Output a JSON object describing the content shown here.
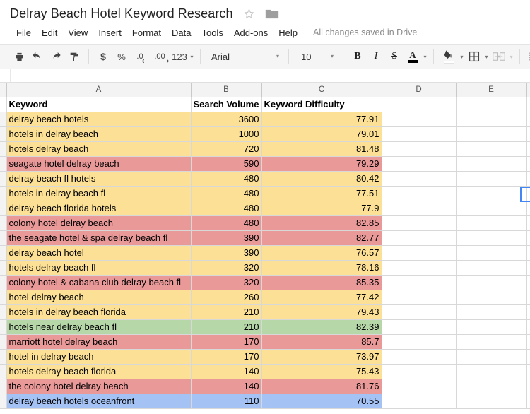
{
  "window": {
    "doc_title": "Delray Beach Hotel Keyword Research",
    "star_icon": "star-outline-icon",
    "folder_icon": "folder-icon"
  },
  "menubar": {
    "items": [
      {
        "label": "File"
      },
      {
        "label": "Edit"
      },
      {
        "label": "View"
      },
      {
        "label": "Insert"
      },
      {
        "label": "Format"
      },
      {
        "label": "Data"
      },
      {
        "label": "Tools"
      },
      {
        "label": "Add-ons"
      },
      {
        "label": "Help"
      }
    ],
    "save_status": "All changes saved in Drive"
  },
  "toolbar": {
    "print": "print-icon",
    "undo": "undo-icon",
    "redo": "redo-icon",
    "paint_format": "paint-format-icon",
    "currency": "$",
    "percent": "%",
    "decrease_decimal": ".0",
    "increase_decimal": ".00",
    "number_format": "123",
    "font_family": "Arial",
    "font_size": "10",
    "bold": "B",
    "italic": "I",
    "strikethrough": "S",
    "text_color": "A",
    "text_color_value": "#000000",
    "fill_color": "fill-color-icon",
    "fill_color_value": "#ffffff",
    "borders": "borders-icon",
    "merge_cells": "merge-cells-icon",
    "align": "align-left-icon"
  },
  "sheet": {
    "column_headers": [
      "A",
      "B",
      "C",
      "D",
      "E"
    ],
    "header_row": [
      "Keyword",
      "Search Volume",
      "Keyword Difficulty"
    ],
    "colors": {
      "yellow": "#fce095",
      "red": "#ea9999",
      "green": "#b6d7a8",
      "blue": "#a4c2f4",
      "white": "#ffffff",
      "selection": "#4285f4"
    },
    "rows": [
      {
        "keyword": "delray beach hotels",
        "volume": "3600",
        "difficulty": "77.91",
        "color": "yellow"
      },
      {
        "keyword": "hotels in delray beach",
        "volume": "1000",
        "difficulty": "79.01",
        "color": "yellow"
      },
      {
        "keyword": "hotels delray beach",
        "volume": "720",
        "difficulty": "81.48",
        "color": "yellow"
      },
      {
        "keyword": "seagate hotel delray beach",
        "volume": "590",
        "difficulty": "79.29",
        "color": "red"
      },
      {
        "keyword": "delray beach fl hotels",
        "volume": "480",
        "difficulty": "80.42",
        "color": "yellow"
      },
      {
        "keyword": "hotels in delray beach fl",
        "volume": "480",
        "difficulty": "77.51",
        "color": "yellow"
      },
      {
        "keyword": "delray beach florida hotels",
        "volume": "480",
        "difficulty": "77.9",
        "color": "yellow"
      },
      {
        "keyword": "colony hotel delray beach",
        "volume": "480",
        "difficulty": "82.85",
        "color": "red"
      },
      {
        "keyword": "the seagate hotel & spa delray beach fl",
        "volume": "390",
        "difficulty": "82.77",
        "color": "red"
      },
      {
        "keyword": "delray beach hotel",
        "volume": "390",
        "difficulty": "76.57",
        "color": "yellow"
      },
      {
        "keyword": "hotels delray beach fl",
        "volume": "320",
        "difficulty": "78.16",
        "color": "yellow"
      },
      {
        "keyword": "colony hotel & cabana club delray beach fl",
        "volume": "320",
        "difficulty": "85.35",
        "color": "red"
      },
      {
        "keyword": "hotel delray beach",
        "volume": "260",
        "difficulty": "77.42",
        "color": "yellow"
      },
      {
        "keyword": "hotels in delray beach florida",
        "volume": "210",
        "difficulty": "79.43",
        "color": "yellow"
      },
      {
        "keyword": "hotels near delray beach fl",
        "volume": "210",
        "difficulty": "82.39",
        "color": "green"
      },
      {
        "keyword": "marriott hotel delray beach",
        "volume": "170",
        "difficulty": "85.7",
        "color": "red"
      },
      {
        "keyword": "hotel in delray beach",
        "volume": "170",
        "difficulty": "73.97",
        "color": "yellow"
      },
      {
        "keyword": "hotels delray beach florida",
        "volume": "140",
        "difficulty": "75.43",
        "color": "yellow"
      },
      {
        "keyword": "the colony hotel delray beach",
        "volume": "140",
        "difficulty": "81.76",
        "color": "red"
      },
      {
        "keyword": "delray beach hotels oceanfront",
        "volume": "110",
        "difficulty": "70.55",
        "color": "blue"
      }
    ]
  }
}
